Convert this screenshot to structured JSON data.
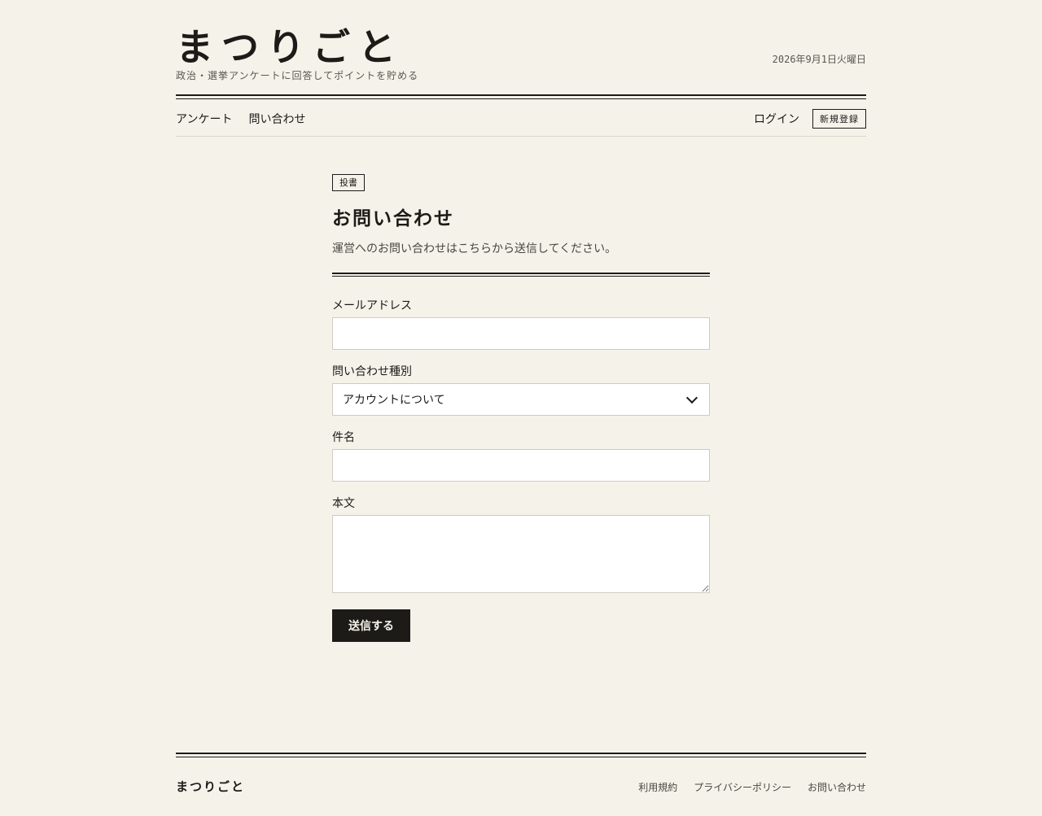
{
  "header": {
    "site_title": "まつりごと",
    "tagline": "政治・選挙アンケートに回答してポイントを貯める",
    "date": "2026年9月1日火曜日"
  },
  "nav": {
    "left_items": [
      "アンケート",
      "問い合わせ"
    ],
    "login": "ログイン",
    "signup": "新規登録"
  },
  "main": {
    "badge": "投書",
    "title": "お問い合わせ",
    "lead": "運営へのお問い合わせはこちらから送信してください。",
    "fields": {
      "email_label": "メールアドレス",
      "email_value": "",
      "category_label": "問い合わせ種別",
      "category_selected": "アカウントについて",
      "subject_label": "件名",
      "subject_value": "",
      "body_label": "本文",
      "body_value": ""
    },
    "submit_label": "送信する"
  },
  "footer": {
    "brand": "まつりごと",
    "links": [
      "利用規約",
      "プライバシーポリシー",
      "お問い合わせ"
    ]
  }
}
